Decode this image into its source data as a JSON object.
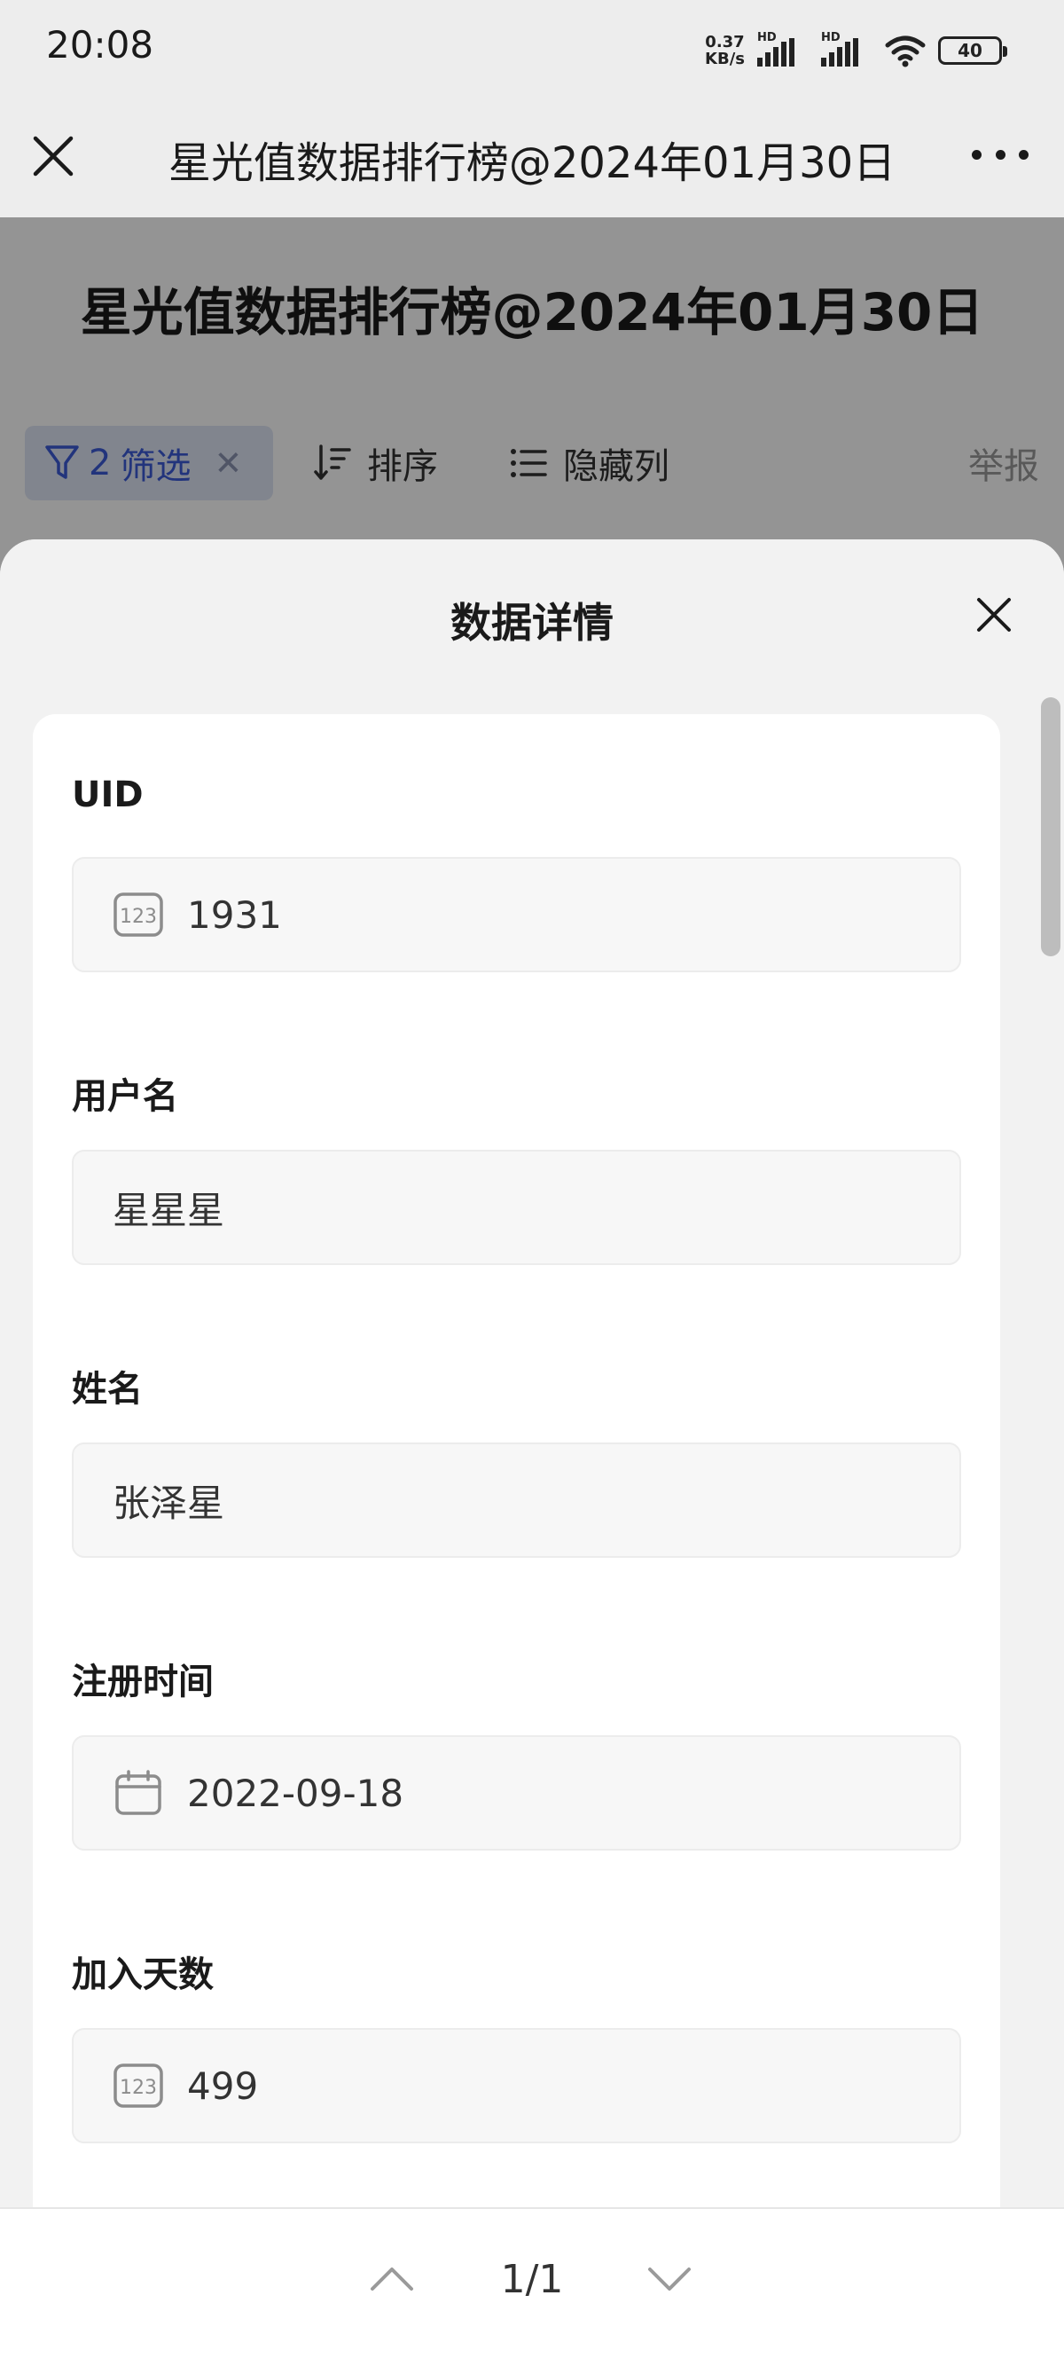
{
  "status_bar": {
    "time": "20:08",
    "net_speed_value": "0.37",
    "net_speed_unit": "KB/s",
    "signal_label_1": "HD",
    "signal_label_2": "HD",
    "battery": "40"
  },
  "nav": {
    "title": "星光值数据排行榜@2024年01月30日",
    "close_icon": "close-icon",
    "more_icon": "more-icon"
  },
  "page": {
    "title": "星光值数据排行榜@2024年01月30日",
    "filter_count": "2",
    "filter_label": "筛选",
    "sort_label": "排序",
    "hide_columns_label": "隐藏列",
    "report_label": "举报"
  },
  "sheet": {
    "title": "数据详情",
    "fields": [
      {
        "label": "UID",
        "value": "1931",
        "icon": "number-icon"
      },
      {
        "label": "用户名",
        "value": "星星星",
        "icon": ""
      },
      {
        "label": "姓名",
        "value": "张泽星",
        "icon": ""
      },
      {
        "label": "注册时间",
        "value": "2022-09-18",
        "icon": "calendar-icon"
      },
      {
        "label": "加入天数",
        "value": "499",
        "icon": "number-icon"
      }
    ]
  },
  "pagination": {
    "text": "1/1"
  },
  "colors": {
    "accent": "#3b5bd6",
    "background": "#ededed",
    "card": "#ffffff",
    "field_bg": "#f7f7f7"
  }
}
